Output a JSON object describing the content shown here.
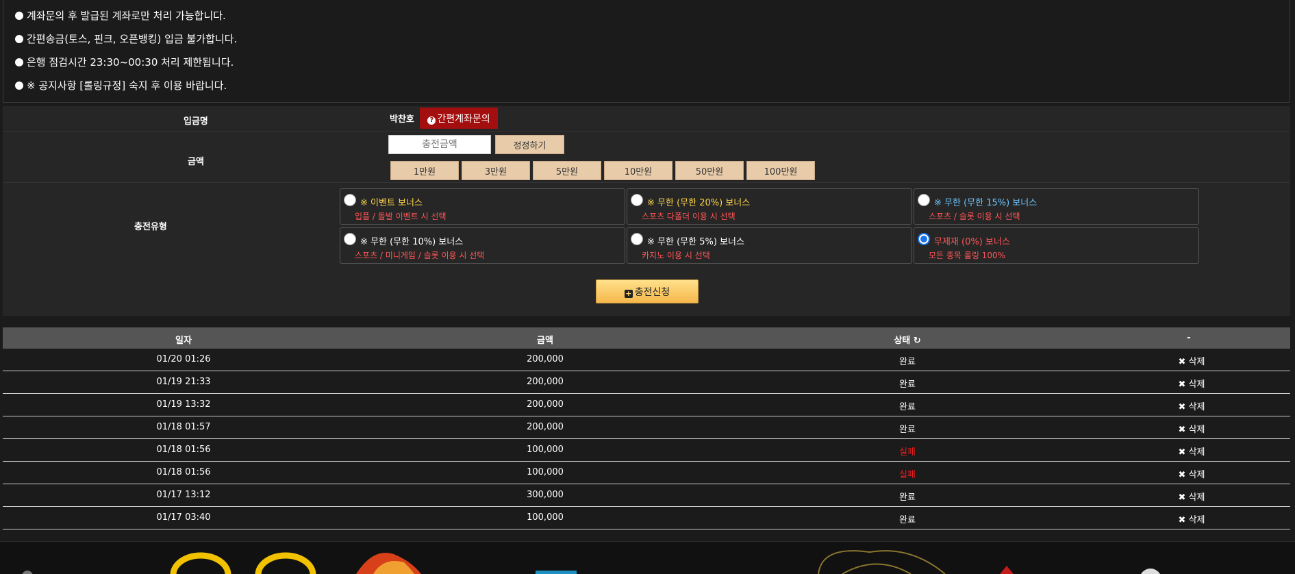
{
  "notices": [
    "계좌문의 후 발급된 계좌로만 처리 가능합니다.",
    "간편송금(토스, 핀크, 오픈뱅킹) 입금 불가합니다.",
    "은행 점검시간 23:30~00:30 처리 제한됩니다.",
    "※ 공지사항 [롤링규정] 숙지 후 이용 바랍니다."
  ],
  "form": {
    "depositor_label": "입금명",
    "depositor_name": "박찬호",
    "inquiry_button": "간편계좌문의",
    "amount_label": "금액",
    "amount_placeholder": "충전금액",
    "reset_button": "정정하기",
    "quick_amounts": [
      "1만원",
      "3만원",
      "5만원",
      "10만원",
      "50만원",
      "100만원"
    ],
    "type_label": "충전유형",
    "options": [
      {
        "title": "※ 이벤트 보너스",
        "desc": "입플 / 돌발 이벤트 시 선택",
        "title_color": "#ffd54a",
        "checked": false
      },
      {
        "title": "※ 무한 (무한 20%) 보너스",
        "desc": "스포츠 다폴더 이용 시 선택",
        "title_color": "#ffd54a",
        "checked": false
      },
      {
        "title": "※ 무한 (무한 15%) 보너스",
        "desc": "스포츠 / 슬롯 이용 시 선택",
        "title_color": "#6ec6ff",
        "checked": false
      },
      {
        "title": "※ 무한 (무한 10%) 보너스",
        "desc": "스포츠 / 미니게임 / 슬롯 이용 시 선택",
        "title_color": "#ffffff",
        "checked": false
      },
      {
        "title": "※ 무한 (무한 5%) 보너스",
        "desc": "카지노 이용 시 선택",
        "title_color": "#ffffff",
        "checked": false
      },
      {
        "title": "무제재 (0%) 보너스",
        "desc": "모든 종목 롤링 100%",
        "title_color": "#ff5555",
        "checked": true
      }
    ],
    "submit_button": "충전신청"
  },
  "history": {
    "headers": {
      "date": "일자",
      "amount": "금액",
      "status": "상태",
      "action": "-"
    },
    "delete_label": "삭제",
    "fail_color": "#e81e1e",
    "rows": [
      {
        "date": "01/20 01:26",
        "amount": "200,000",
        "status": "완료",
        "fail": false
      },
      {
        "date": "01/19 21:33",
        "amount": "200,000",
        "status": "완료",
        "fail": false
      },
      {
        "date": "01/19 13:32",
        "amount": "200,000",
        "status": "완료",
        "fail": false
      },
      {
        "date": "01/18 01:57",
        "amount": "200,000",
        "status": "완료",
        "fail": false
      },
      {
        "date": "01/18 01:56",
        "amount": "100,000",
        "status": "실패",
        "fail": true
      },
      {
        "date": "01/18 01:56",
        "amount": "100,000",
        "status": "실패",
        "fail": true
      },
      {
        "date": "01/17 13:12",
        "amount": "300,000",
        "status": "완료",
        "fail": false
      },
      {
        "date": "01/17 03:40",
        "amount": "100,000",
        "status": "완료",
        "fail": false
      }
    ]
  },
  "icons": {
    "question": "question-circle-icon",
    "plus": "plus-square-icon",
    "refresh": "refresh-icon",
    "delete": "close-icon"
  }
}
